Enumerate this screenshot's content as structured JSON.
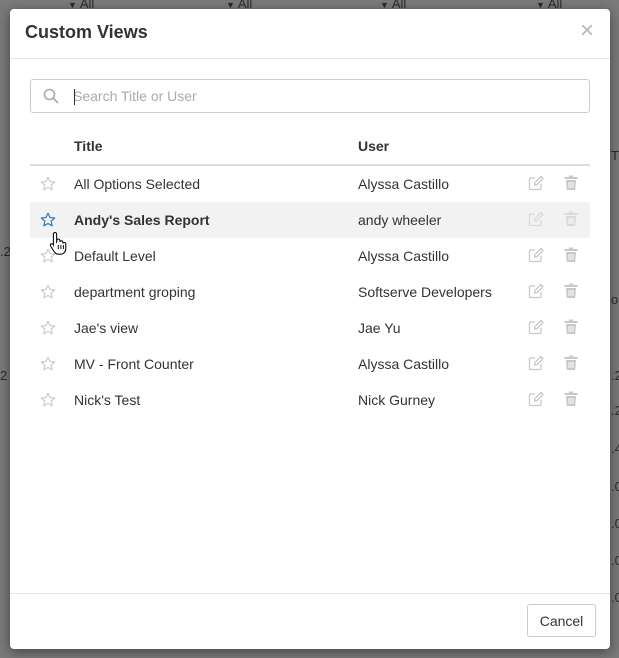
{
  "background": {
    "filters": [
      "All",
      "All",
      "All",
      "All"
    ],
    "right_fragments": [
      "T",
      "o",
      ".2",
      ".2",
      ".4",
      ".0",
      ".0",
      ".0",
      ".0"
    ],
    "left_fragments": [
      ".2",
      "2 I"
    ]
  },
  "modal": {
    "title": "Custom Views",
    "close_symbol": "×",
    "search": {
      "placeholder": "Search Title or User",
      "value": ""
    },
    "columns": {
      "title": "Title",
      "user": "User"
    },
    "rows": [
      {
        "title": "All Options Selected",
        "user": "Alyssa Castillo"
      },
      {
        "title": "Andy's Sales Report",
        "user": "andy wheeler"
      },
      {
        "title": "Default Level",
        "user": "Alyssa Castillo"
      },
      {
        "title": "department groping",
        "user": "Softserve Developers"
      },
      {
        "title": "Jae's view",
        "user": "Jae Yu"
      },
      {
        "title": "MV - Front Counter",
        "user": "Alyssa Castillo"
      },
      {
        "title": "Nick's Test",
        "user": "Nick Gurney"
      }
    ],
    "hovered_row": "Andy's Sales Report",
    "cancel_label": "Cancel"
  },
  "colors": {
    "star_outline": "#cccccc",
    "star_hover": "#337ab7",
    "action_icon": "#c8c8c8"
  },
  "icons": {
    "star": "star-icon",
    "edit": "edit-icon",
    "trash": "trash-icon",
    "search": "search-icon",
    "close": "close-icon"
  }
}
